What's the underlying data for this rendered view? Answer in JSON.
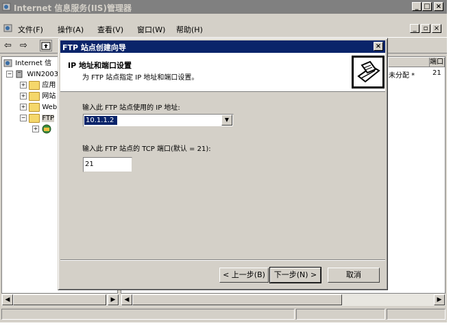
{
  "main_window": {
    "title": "Internet 信息服务(IIS)管理器",
    "menu": [
      {
        "label": "文件(F)"
      },
      {
        "label": "操作(A)"
      },
      {
        "label": "查看(V)"
      },
      {
        "label": "窗口(W)"
      },
      {
        "label": "帮助(H)"
      }
    ],
    "tree": {
      "root": "Internet 信",
      "server": "WIN2003",
      "items": [
        "应用",
        "网站",
        "Web",
        "FTP"
      ]
    },
    "list": {
      "col_port": "端口",
      "row_status": "未分配 *",
      "row_port": "21"
    }
  },
  "wizard": {
    "title": "FTP 站点创建向导",
    "heading": "IP 地址和端口设置",
    "subheading": "为 FTP 站点指定 IP 地址和端口设置。",
    "ip_label": "输入此 FTP 站点使用的 IP 地址:",
    "ip_value": "10.1.1.2",
    "port_label": "输入此 FTP 站点的 TCP 端口(默认 = 21):",
    "port_value": "21",
    "back_button": "< 上一步(B)",
    "next_button": "下一步(N) >",
    "cancel_button": "取消"
  }
}
